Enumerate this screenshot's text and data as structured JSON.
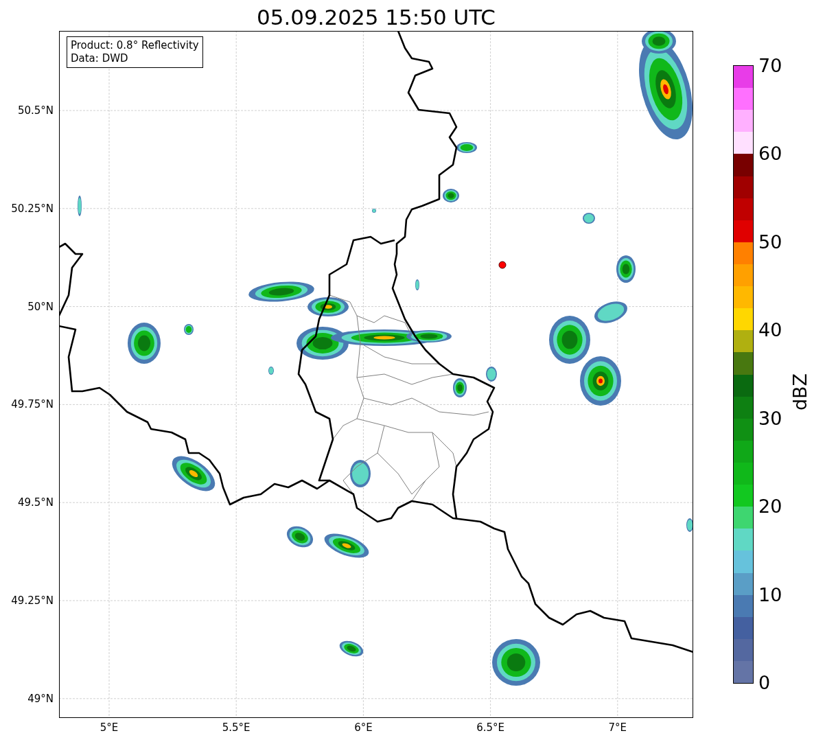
{
  "title": "05.09.2025 15:50 UTC",
  "info_box": {
    "lines": [
      "Product: 0.8° Reflectivity",
      "Data: DWD"
    ]
  },
  "map": {
    "lat_ticks": [
      "50.5°N",
      "50.25°N",
      "50°N",
      "49.75°N",
      "49.5°N",
      "49.25°N",
      "49°N"
    ],
    "lon_ticks": [
      "5°E",
      "5.5°E",
      "6°E",
      "6.5°E",
      "7°E"
    ]
  },
  "colorbar": {
    "label": "dBZ",
    "ticks": [
      "70",
      "60",
      "50",
      "40",
      "30",
      "20",
      "10",
      "0"
    ],
    "bins": [
      {
        "color": "#6474a6"
      },
      {
        "color": "#5468a0"
      },
      {
        "color": "#4460a0"
      },
      {
        "color": "#4a7ab2"
      },
      {
        "color": "#5a9ec6"
      },
      {
        "color": "#66c2dc"
      },
      {
        "color": "#60d8c4"
      },
      {
        "color": "#3ed670"
      },
      {
        "color": "#12c820"
      },
      {
        "color": "#10b81a"
      },
      {
        "color": "#10a818"
      },
      {
        "color": "#109014"
      },
      {
        "color": "#0e8012"
      },
      {
        "color": "#0a6a10"
      },
      {
        "color": "#487810"
      },
      {
        "color": "#b0b010"
      },
      {
        "color": "#ffd700"
      },
      {
        "color": "#ffb800"
      },
      {
        "color": "#ffa000"
      },
      {
        "color": "#ff8000"
      },
      {
        "color": "#e00000"
      },
      {
        "color": "#c00000"
      },
      {
        "color": "#a00000"
      },
      {
        "color": "#780000"
      },
      {
        "color": "#ffe0ff"
      },
      {
        "color": "#ffb0ff"
      },
      {
        "color": "#ff70ff"
      },
      {
        "color": "#e83ce8"
      }
    ]
  }
}
